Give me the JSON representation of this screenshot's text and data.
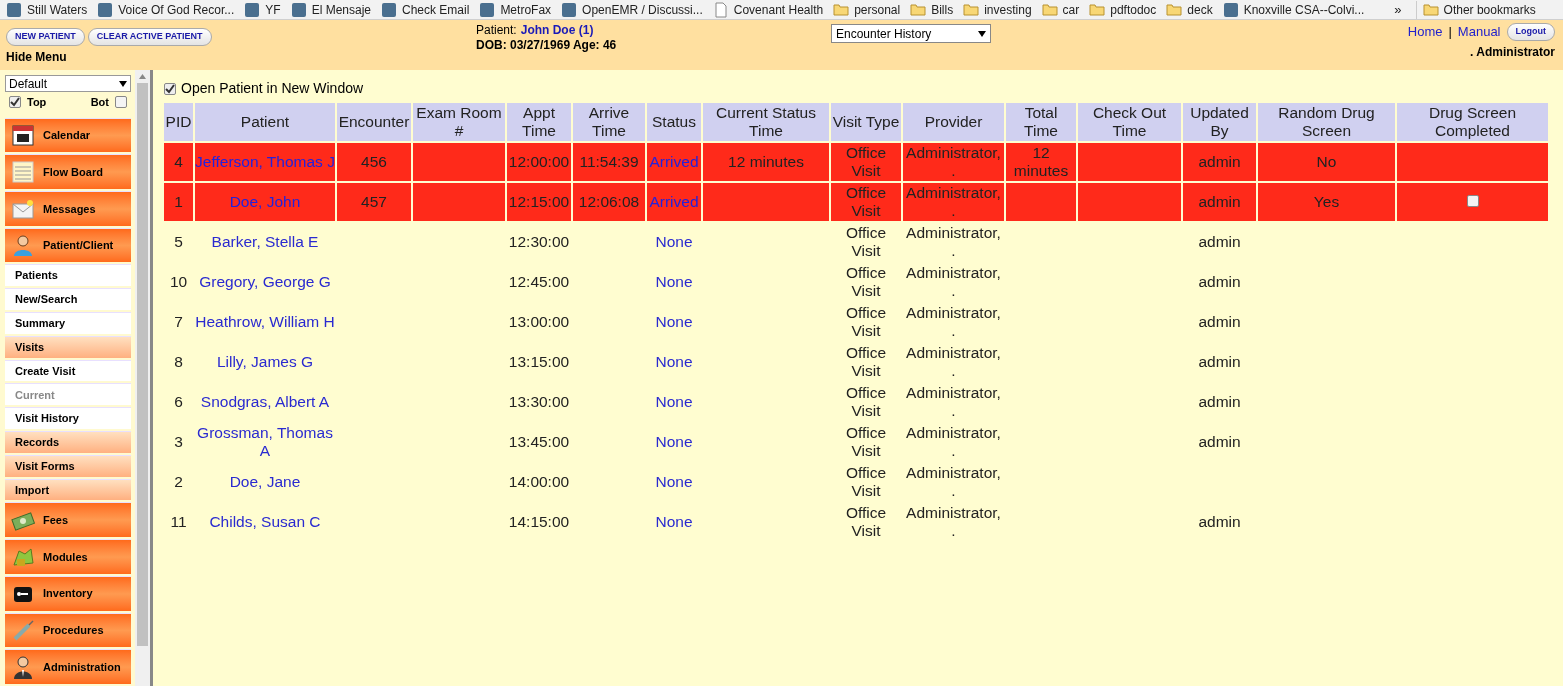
{
  "bookmarks": [
    {
      "label": "Still Waters",
      "kind": "site"
    },
    {
      "label": "Voice Of God Recor...",
      "kind": "site"
    },
    {
      "label": "YF",
      "kind": "site"
    },
    {
      "label": "El Mensaje",
      "kind": "site"
    },
    {
      "label": "Check Email",
      "kind": "site"
    },
    {
      "label": "MetroFax",
      "kind": "site"
    },
    {
      "label": "OpenEMR / Discussi...",
      "kind": "site"
    },
    {
      "label": "Covenant Health",
      "kind": "page"
    },
    {
      "label": "personal",
      "kind": "folder"
    },
    {
      "label": "Bills",
      "kind": "folder"
    },
    {
      "label": "investing",
      "kind": "folder"
    },
    {
      "label": "car",
      "kind": "folder"
    },
    {
      "label": "pdftodoc",
      "kind": "folder"
    },
    {
      "label": "deck",
      "kind": "folder"
    },
    {
      "label": "Knoxville CSA--Colvi...",
      "kind": "site"
    }
  ],
  "bookmarks_more": "»",
  "other_bookmarks": "Other bookmarks",
  "header": {
    "buttons": [
      "NEW PATIENT",
      "CLEAR ACTIVE PATIENT"
    ],
    "hide_menu": "Hide Menu",
    "patient_label": "Patient:",
    "patient_name": "John Doe (1)",
    "dob_line": "DOB: 03/27/1969 Age: 46",
    "view_select": "Encounter History",
    "links": [
      "Home",
      "Manual"
    ],
    "separator": "|",
    "logout": "Logout",
    "user": ". Administrator"
  },
  "sidebar": {
    "layout_select": "Default",
    "top": {
      "label": "Top",
      "checked": true
    },
    "bot": {
      "label": "Bot",
      "checked": false
    },
    "items": [
      {
        "label": "Calendar",
        "kind": "main",
        "disabled": false
      },
      {
        "label": "Flow Board",
        "kind": "main",
        "disabled": false
      },
      {
        "label": "Messages",
        "kind": "main",
        "disabled": false
      },
      {
        "label": "Patient/Client",
        "kind": "main",
        "disabled": false
      },
      {
        "label": "Patients",
        "kind": "sub",
        "disabled": false
      },
      {
        "label": "New/Search",
        "kind": "sub",
        "disabled": false
      },
      {
        "label": "Summary",
        "kind": "sub",
        "disabled": false
      },
      {
        "label": "Visits",
        "kind": "section",
        "disabled": false
      },
      {
        "label": "Create Visit",
        "kind": "sub",
        "disabled": false
      },
      {
        "label": "Current",
        "kind": "sub",
        "disabled": true
      },
      {
        "label": "Visit History",
        "kind": "sub",
        "disabled": false
      },
      {
        "label": "Records",
        "kind": "section",
        "disabled": false
      },
      {
        "label": "Visit Forms",
        "kind": "section",
        "disabled": false
      },
      {
        "label": "Import",
        "kind": "section",
        "disabled": false
      },
      {
        "label": "Fees",
        "kind": "main",
        "disabled": false
      },
      {
        "label": "Modules",
        "kind": "main",
        "disabled": false
      },
      {
        "label": "Inventory",
        "kind": "main",
        "disabled": false
      },
      {
        "label": "Procedures",
        "kind": "main",
        "disabled": false
      },
      {
        "label": "Administration",
        "kind": "main",
        "disabled": false
      }
    ]
  },
  "open_new_window": {
    "label": "Open Patient in New Window",
    "checked": true
  },
  "table": {
    "columns": [
      "PID",
      "Patient",
      "Encounter",
      "Exam Room #",
      "Appt Time",
      "Arrive Time",
      "Status",
      "Current Status Time",
      "Visit Type",
      "Provider",
      "Total Time",
      "Check Out Time",
      "Updated By",
      "Random Drug Screen",
      "Drug Screen Completed"
    ],
    "rows": [
      {
        "highlighted": true,
        "pid": "4",
        "patient": "Jefferson, Thomas J",
        "encounter": "456",
        "appt_time": "12:00:00",
        "arrive_time": "11:54:39",
        "status": "Arrived",
        "current_status_time": "12 minutes",
        "visit_type": "Office Visit",
        "provider": "Administrator, .",
        "total_time": "12 minutes",
        "updated_by": "admin",
        "random_drug_screen": "No"
      },
      {
        "highlighted": true,
        "pid": "1",
        "patient": "Doe, John",
        "encounter": "457",
        "appt_time": "12:15:00",
        "arrive_time": "12:06:08",
        "status": "Arrived",
        "visit_type": "Office Visit",
        "provider": "Administrator, .",
        "updated_by": "admin",
        "random_drug_screen": "Yes",
        "drug_screen_completed": {
          "checked": false
        }
      },
      {
        "highlighted": false,
        "pid": "5",
        "patient": "Barker, Stella E",
        "appt_time": "12:30:00",
        "status": "None",
        "visit_type": "Office Visit",
        "provider": "Administrator, .",
        "updated_by": "admin"
      },
      {
        "highlighted": false,
        "pid": "10",
        "patient": "Gregory, George G",
        "appt_time": "12:45:00",
        "status": "None",
        "visit_type": "Office Visit",
        "provider": "Administrator, .",
        "updated_by": "admin"
      },
      {
        "highlighted": false,
        "pid": "7",
        "patient": "Heathrow, William H",
        "appt_time": "13:00:00",
        "status": "None",
        "visit_type": "Office Visit",
        "provider": "Administrator, .",
        "updated_by": "admin"
      },
      {
        "highlighted": false,
        "pid": "8",
        "patient": "Lilly, James G",
        "appt_time": "13:15:00",
        "status": "None",
        "visit_type": "Office Visit",
        "provider": "Administrator, .",
        "updated_by": "admin"
      },
      {
        "highlighted": false,
        "pid": "6",
        "patient": "Snodgras, Albert A",
        "appt_time": "13:30:00",
        "status": "None",
        "visit_type": "Office Visit",
        "provider": "Administrator, .",
        "updated_by": "admin"
      },
      {
        "highlighted": false,
        "pid": "3",
        "patient": "Grossman, Thomas A",
        "appt_time": "13:45:00",
        "status": "None",
        "visit_type": "Office Visit",
        "provider": "Administrator, .",
        "updated_by": "admin"
      },
      {
        "highlighted": false,
        "pid": "2",
        "patient": "Doe, Jane",
        "appt_time": "14:00:00",
        "status": "None",
        "visit_type": "Office Visit",
        "provider": "Administrator, ."
      },
      {
        "highlighted": false,
        "pid": "11",
        "patient": "Childs, Susan C",
        "appt_time": "14:15:00",
        "status": "None",
        "visit_type": "Office Visit",
        "provider": "Administrator, .",
        "updated_by": "admin"
      }
    ]
  }
}
